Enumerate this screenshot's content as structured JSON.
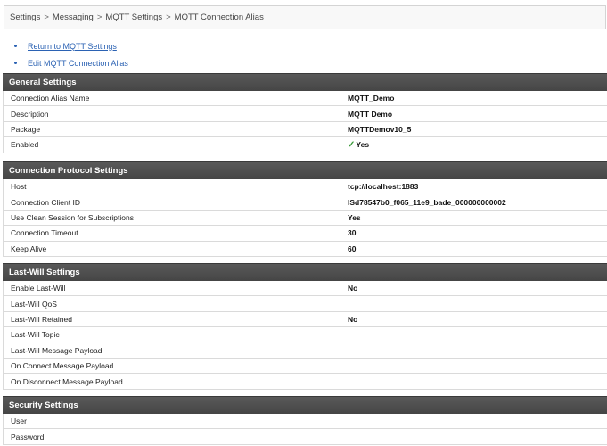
{
  "breadcrumb": {
    "items": [
      "Settings",
      "Messaging",
      "MQTT Settings",
      "MQTT Connection Alias"
    ],
    "separator": ">"
  },
  "actions": {
    "return_link": "Return to MQTT Settings",
    "edit_link": "Edit MQTT Connection Alias"
  },
  "sections": {
    "general": {
      "title": "General Settings",
      "rows": [
        {
          "label": "Connection Alias Name",
          "value": "MQTT_Demo"
        },
        {
          "label": "Description",
          "value": "MQTT Demo"
        },
        {
          "label": "Package",
          "value": "MQTTDemov10_5"
        },
        {
          "label": "Enabled",
          "value": "Yes"
        }
      ]
    },
    "protocol": {
      "title": "Connection Protocol Settings",
      "rows": [
        {
          "label": "Host",
          "value": "tcp://localhost:1883"
        },
        {
          "label": "Connection Client ID",
          "value": "ISd78547b0_f065_11e9_bade_000000000002"
        },
        {
          "label": "Use Clean Session for Subscriptions",
          "value": "Yes"
        },
        {
          "label": "Connection Timeout",
          "value": "30"
        },
        {
          "label": "Keep Alive",
          "value": "60"
        }
      ]
    },
    "lastwill": {
      "title": "Last-Will Settings",
      "rows": [
        {
          "label": "Enable Last-Will",
          "value": "No"
        },
        {
          "label": "Last-Will QoS",
          "value": ""
        },
        {
          "label": "Last-Will Retained",
          "value": "No"
        },
        {
          "label": "Last-Will Topic",
          "value": ""
        },
        {
          "label": "Last-Will Message Payload",
          "value": ""
        },
        {
          "label": "On Connect Message Payload",
          "value": ""
        },
        {
          "label": "On Disconnect Message Payload",
          "value": ""
        }
      ]
    },
    "security": {
      "title": "Security Settings",
      "rows": [
        {
          "label": "User",
          "value": ""
        },
        {
          "label": "Password",
          "value": ""
        }
      ]
    }
  },
  "colors": {
    "header_bg": "#4a4a4a",
    "link": "#2b62b3",
    "check": "#3a9a3a"
  },
  "icons": {
    "enabled_check": "checkmark-icon"
  }
}
